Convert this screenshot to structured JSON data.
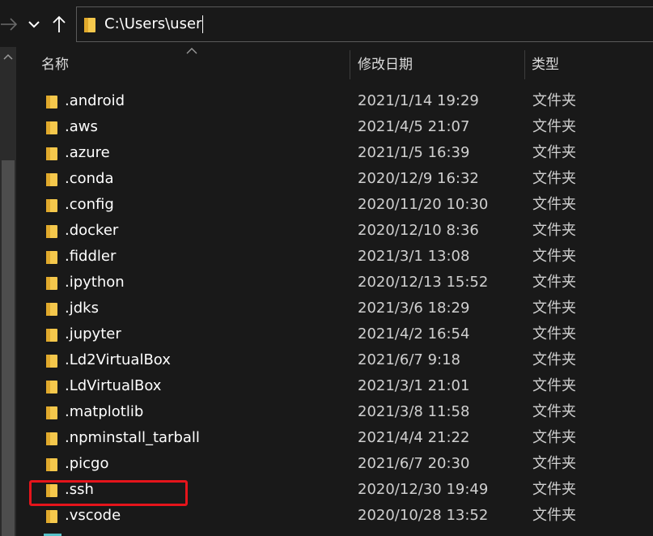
{
  "address": {
    "path": "C:\\Users\\user"
  },
  "columns": {
    "name": "名称",
    "date": "修改日期",
    "type": "类型"
  },
  "files": [
    {
      "name": ".android",
      "date": "2021/1/14 19:29",
      "type": "文件夹"
    },
    {
      "name": ".aws",
      "date": "2021/4/5 21:07",
      "type": "文件夹"
    },
    {
      "name": ".azure",
      "date": "2021/1/5 16:39",
      "type": "文件夹"
    },
    {
      "name": ".conda",
      "date": "2020/12/9 16:32",
      "type": "文件夹"
    },
    {
      "name": ".config",
      "date": "2020/11/20 10:30",
      "type": "文件夹"
    },
    {
      "name": ".docker",
      "date": "2020/12/10 8:36",
      "type": "文件夹"
    },
    {
      "name": ".fiddler",
      "date": "2021/3/1 13:08",
      "type": "文件夹"
    },
    {
      "name": ".ipython",
      "date": "2020/12/13 15:52",
      "type": "文件夹"
    },
    {
      "name": ".jdks",
      "date": "2021/3/6 18:29",
      "type": "文件夹"
    },
    {
      "name": ".jupyter",
      "date": "2021/4/2 16:54",
      "type": "文件夹"
    },
    {
      "name": ".Ld2VirtualBox",
      "date": "2021/6/7 9:18",
      "type": "文件夹"
    },
    {
      "name": ".LdVirtualBox",
      "date": "2021/3/1 21:01",
      "type": "文件夹"
    },
    {
      "name": ".matplotlib",
      "date": "2021/3/8 11:58",
      "type": "文件夹"
    },
    {
      "name": ".npminstall_tarball",
      "date": "2021/4/4 21:22",
      "type": "文件夹"
    },
    {
      "name": ".picgo",
      "date": "2021/6/7 20:30",
      "type": "文件夹"
    },
    {
      "name": ".ssh",
      "date": "2020/12/30 19:49",
      "type": "文件夹"
    },
    {
      "name": ".vscode",
      "date": "2020/10/28 13:52",
      "type": "文件夹"
    }
  ],
  "icons": {
    "forward": "arrow-right-icon",
    "recent": "chevron-down-icon",
    "up": "arrow-up-icon",
    "folder": "folder-icon"
  },
  "colors": {
    "folder": "#f5c84c",
    "highlight": "#e5141b",
    "background": "#191919"
  }
}
